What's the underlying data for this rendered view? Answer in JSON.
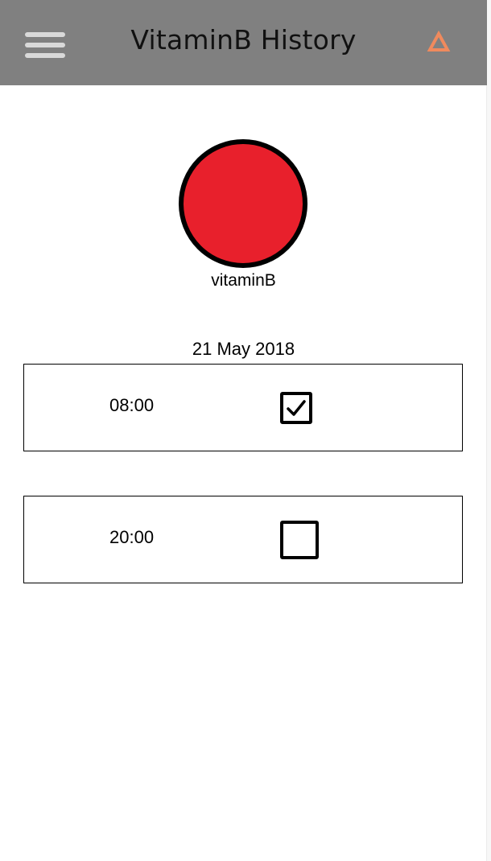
{
  "header": {
    "title": "VitaminB History",
    "menu_icon": "hamburger-menu-icon",
    "alert_icon": "triangle-warning-icon",
    "alert_color": "#f08a5d",
    "bar_color": "#808080"
  },
  "medication": {
    "name": "vitaminB",
    "pill_color": "#e8202c"
  },
  "history": {
    "date": "21 May 2018",
    "doses": [
      {
        "time": "08:00",
        "taken": true
      },
      {
        "time": "20:00",
        "taken": false
      }
    ]
  }
}
